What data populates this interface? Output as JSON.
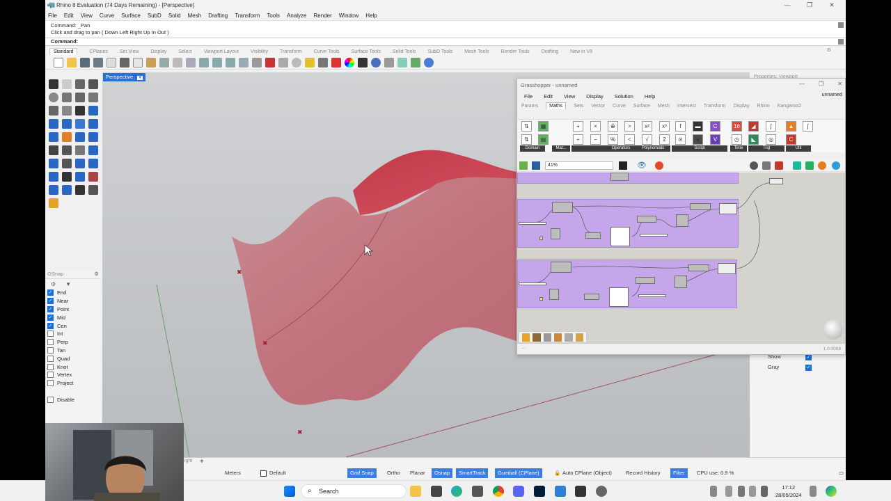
{
  "window": {
    "title": "Rhino 8 Evaluation (74 Days Remaining) - [Perspective]",
    "controls": [
      "—",
      "❐",
      "✕"
    ]
  },
  "menu": [
    "File",
    "Edit",
    "View",
    "Curve",
    "Surface",
    "SubD",
    "Solid",
    "Mesh",
    "Drafting",
    "Transform",
    "Tools",
    "Analyze",
    "Render",
    "Window",
    "Help"
  ],
  "command": {
    "history1": "Command: _Pan",
    "history2": "Click and drag to pan ( Down  Left  Right  Up  In  Out )",
    "prompt": "Command:"
  },
  "toolbar_tabs": [
    "Standard",
    "CPlanes",
    "Set View",
    "Display",
    "Select",
    "Viewport Layout",
    "Visibility",
    "Transform",
    "Curve Tools",
    "Surface Tools",
    "Solid Tools",
    "SubD Tools",
    "Mesh Tools",
    "Render Tools",
    "Drafting",
    "New in V8"
  ],
  "viewport": {
    "name": "Perspective",
    "surface_color": "#c23a4a"
  },
  "osnap": {
    "header": "OSnap",
    "items": [
      {
        "label": "End",
        "checked": true
      },
      {
        "label": "Near",
        "checked": true
      },
      {
        "label": "Point",
        "checked": true
      },
      {
        "label": "Mid",
        "checked": true
      },
      {
        "label": "Cen",
        "checked": true
      },
      {
        "label": "Int",
        "checked": false
      },
      {
        "label": "Perp",
        "checked": false
      },
      {
        "label": "Tan",
        "checked": false
      },
      {
        "label": "Quad",
        "checked": false
      },
      {
        "label": "Knot",
        "checked": false
      },
      {
        "label": "Vertex",
        "checked": false
      },
      {
        "label": "Project",
        "checked": false
      }
    ],
    "disable": "Disable"
  },
  "properties": {
    "header": "Properties: Viewport",
    "show": "Show",
    "gray": "Gray"
  },
  "status": {
    "viewport_tab": "ight",
    "plus": "+",
    "units": "Meters",
    "layer": "Default",
    "grid_snap": "Grid Snap",
    "ortho": "Ortho",
    "planar": "Planar",
    "osnap": "Osnap",
    "smarttrack": "SmartTrack",
    "gumball": "Gumball (CPlane)",
    "autocplane": "Auto CPlane (Object)",
    "record_history": "Record History",
    "filter": "Filter",
    "cpu": "CPU use: 0.9 %"
  },
  "grasshopper": {
    "title": "Grasshopper - unnamed",
    "menu": [
      "File",
      "Edit",
      "View",
      "Display",
      "Solution",
      "Help"
    ],
    "doc": "unnamed",
    "tabs": [
      "Params",
      "Maths",
      "Sets",
      "Vector",
      "Curve",
      "Surface",
      "Mesh",
      "Intersect",
      "Transform",
      "Display",
      "Rhino",
      "Kangaroo2"
    ],
    "active_tab": "Maths",
    "categories": [
      "Domain",
      "Mat...",
      "Operators",
      "Polynomials",
      "Script",
      "Time",
      "Trig",
      "Util"
    ],
    "zoom": "41%",
    "version": "1.0.0008",
    "status_dots": "..."
  },
  "taskbar": {
    "search": "Search",
    "time": "17:12",
    "date": "28/05/2024"
  },
  "colors": {
    "accent_blue": "#3d7de0",
    "gh_group": "#c6a6ea",
    "viewport_bg": "#c4c7ca"
  }
}
